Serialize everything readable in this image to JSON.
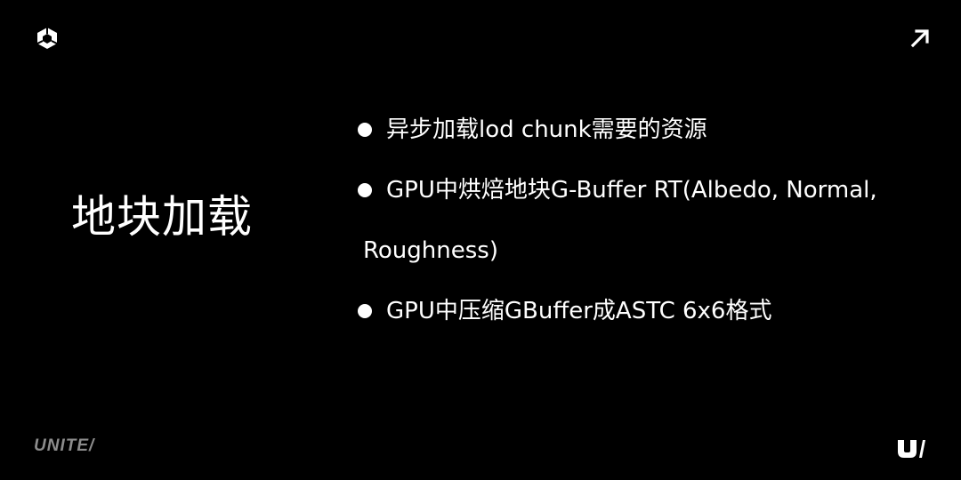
{
  "slide": {
    "title": "地块加载",
    "bullets": [
      {
        "line1": "异步加载lod chunk需要的资源",
        "line2": ""
      },
      {
        "line1": "GPU中烘焙地块G-Buffer RT(Albedo, Normal,",
        "line2": "Roughness)"
      },
      {
        "line1": "GPU中压缩GBuffer成ASTC 6x6格式",
        "line2": ""
      }
    ]
  },
  "branding": {
    "wordmark": "UNITE/",
    "top_left_icon": "unity-cube-logo-icon",
    "top_right_icon": "arrow-up-right-icon",
    "bottom_right_icon": "unite-mark-icon"
  },
  "colors": {
    "background": "#000000",
    "text": "#ffffff",
    "wordmark": "#8c8c8c"
  }
}
